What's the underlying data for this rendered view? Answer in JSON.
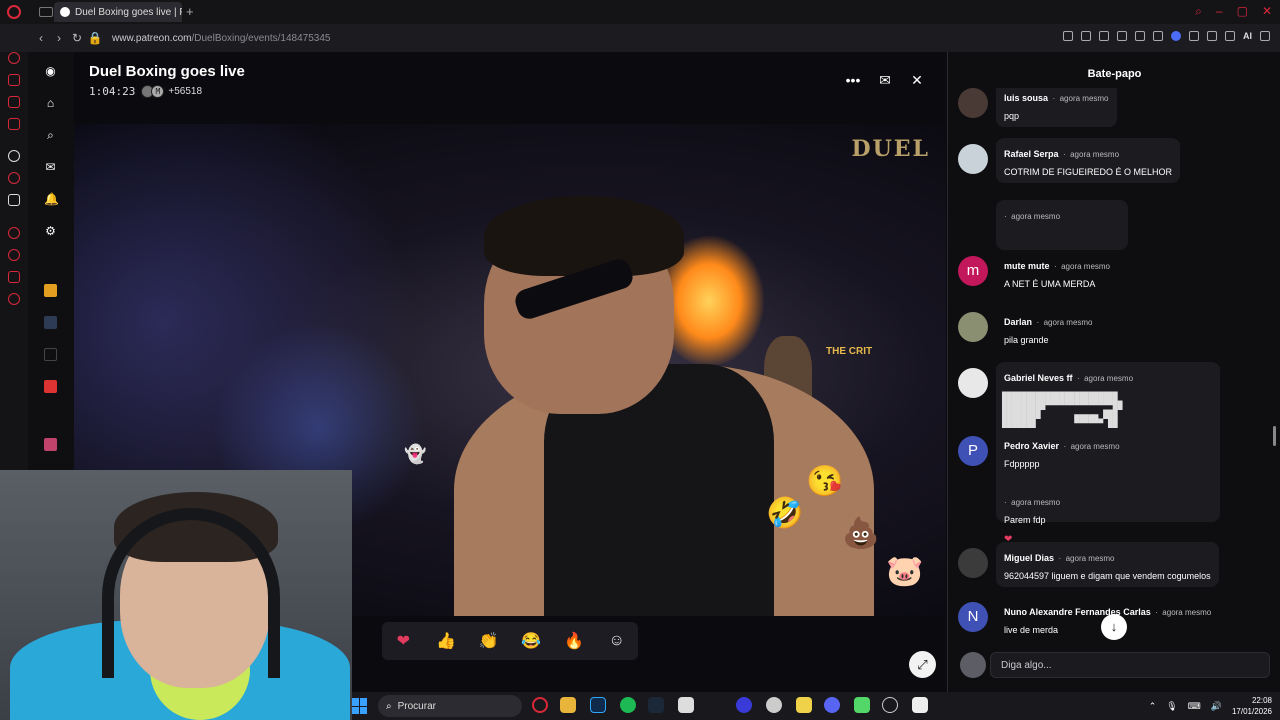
{
  "browser": {
    "tab_title": "Duel Boxing goes live | Pa",
    "url_domain": "www.patreon.com",
    "url_path": "/DuelBoxing/events/148475345",
    "ai_label": "AI"
  },
  "stream": {
    "title": "Duel Boxing goes live",
    "timer": "1:04:23",
    "mini_avatar_letter": "M",
    "viewers": "+56518",
    "logo_text": "DUEL",
    "stage_sign": "THE CRIT"
  },
  "reactions": [
    "❤",
    "👍",
    "👏",
    "😂",
    "🔥",
    "☺"
  ],
  "chat": {
    "title": "Bate-papo",
    "input_placeholder": "Diga algo...",
    "messages": [
      {
        "name": "luis sousa",
        "when": "agora mesmo",
        "text": "pqp",
        "avatar": "",
        "color": "#4a3a36"
      },
      {
        "name": "Rafael Serpa",
        "when": "agora mesmo",
        "text": "COTRIM DE FIGUEIREDO É O MELHOR",
        "avatar": "",
        "color": "#c9d2d9"
      },
      {
        "name": "",
        "when": "agora mesmo",
        "text": "",
        "avatar": "",
        "color": ""
      },
      {
        "name": "mute mute",
        "when": "agora mesmo",
        "text": "A NET É UMA MERDA",
        "avatar": "m",
        "color": "#c2185b"
      },
      {
        "name": "Darlan",
        "when": "agora mesmo",
        "text": "pila grande",
        "avatar": "",
        "color": "#8a8f72"
      },
      {
        "name": "Gabriel Neves ff",
        "when": "agora mesmo",
        "text": "",
        "avatar": "",
        "color": "#e8e8e8"
      },
      {
        "name": "Pedro Xavier",
        "when": "agora mesmo",
        "text": "Fdppppp",
        "avatar": "P",
        "color": "#3f51b5"
      },
      {
        "name": "",
        "when": "agora mesmo",
        "text": "Parem fdp",
        "avatar": "",
        "color": ""
      },
      {
        "name": "Miguel Dias",
        "when": "agora mesmo",
        "text": "962044597 liguem e digam que vendem cogumelos",
        "avatar": "",
        "color": "#3b3b3b"
      },
      {
        "name": "Nuno Alexandre Fernandes Carlas",
        "when": "agora mesmo",
        "text": "live de merda",
        "avatar": "N",
        "color": "#3f51b5"
      }
    ],
    "reaction_row": "❤"
  },
  "taskbar": {
    "search_label": "Procurar",
    "time": "22:08",
    "date": "17/01/2026"
  }
}
